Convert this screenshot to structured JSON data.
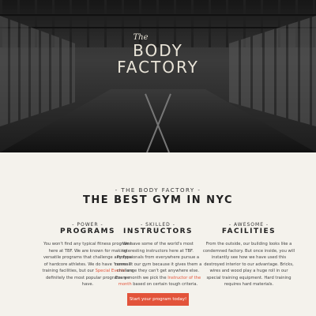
{
  "hero": {
    "logo_small": "The",
    "logo_line1": "BODY",
    "logo_line2": "FACTORY"
  },
  "intro": {
    "kicker": "- THE BODY FACTORY -",
    "headline": "THE BEST GYM IN NYC"
  },
  "columns": [
    {
      "kicker": "- POWER -",
      "title": "PROGRAMS",
      "text_before": "You won't find any typical fitness programs here at TBF. We are known for making versatile programs that challenge any type of hardcore athletes. We do have \"normal\" training facilities, but our ",
      "link": "Special Events",
      "text_after": " are definitely the most popular programs we have."
    },
    {
      "kicker": "- SKILLED -",
      "title": "INSTRUCTORS",
      "text_before": "We have some of the world's most interesting instructors here at TBF. Professionals from everywhere pursue a career at our gym because it gives them a challenge they can't get anywhere else. Every month we pick the ",
      "link": "Instructor of the month",
      "text_after": " based on certain tough criteria."
    },
    {
      "kicker": "- AWESOME -",
      "title": "FACILITIES",
      "text_before": "From the outside, our building looks like a condemned factory. But once inside, you will instantly see how we have used this destroyed interior to our advantage. Bricks, wires and wood play a huge roll in our special training equipment. Hard training requires hard materials.",
      "link": "",
      "text_after": ""
    }
  ],
  "cta": {
    "label": "Start your program today!",
    "color": "#e2533a"
  }
}
